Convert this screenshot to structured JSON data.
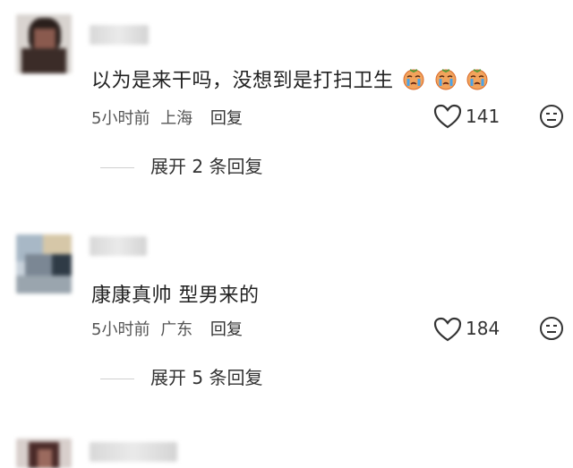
{
  "comments": [
    {
      "text": "以为是来干吗，没想到是打扫卫生",
      "emoji_icon": "crying-face-icon",
      "time": "5小时前",
      "location": "上海",
      "reply_label": "回复",
      "likes": "141",
      "expand_label": "展开 2 条回复"
    },
    {
      "text": "康康真帅 型男来的",
      "time": "5小时前",
      "location": "广东",
      "reply_label": "回复",
      "likes": "184",
      "expand_label": "展开 5 条回复"
    }
  ],
  "icons": {
    "like": "heart-icon",
    "dislike": "dislike-face-icon"
  }
}
